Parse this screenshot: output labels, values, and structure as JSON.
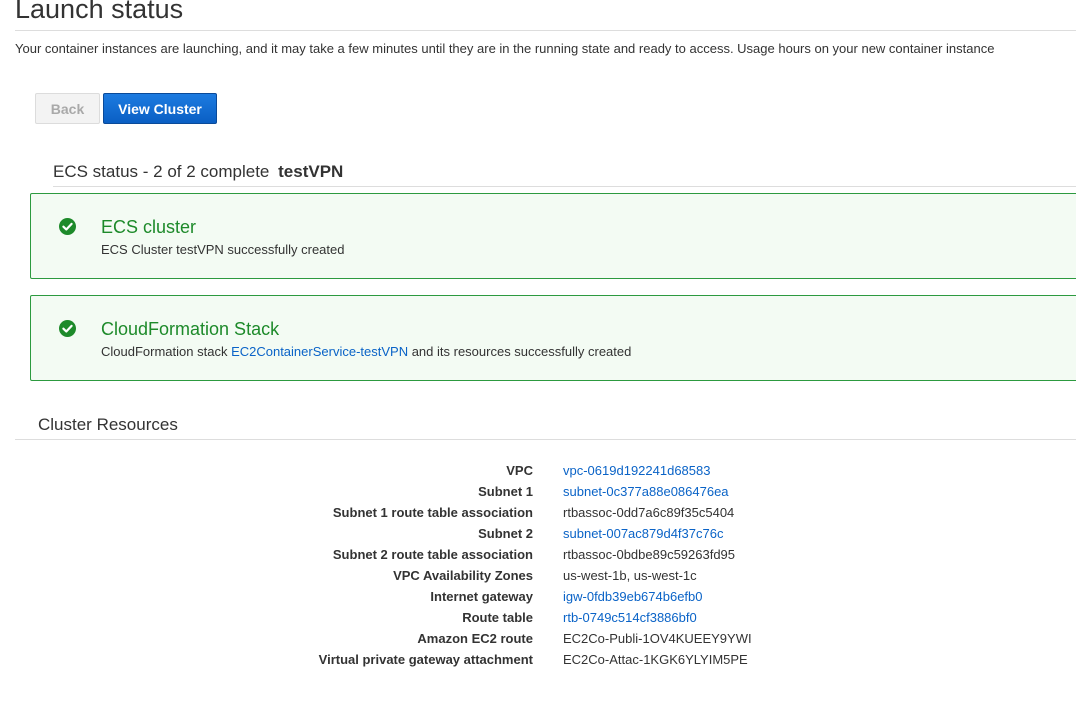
{
  "page": {
    "title": "Launch status",
    "intro": "Your container instances are launching, and it may take a few minutes until they are in the running state and ready to access. Usage hours on your new container instance"
  },
  "buttons": {
    "back_label": "Back",
    "view_cluster_label": "View Cluster"
  },
  "ecs_status": {
    "heading_prefix": "ECS status - 2 of 2 complete",
    "cluster_name": "testVPN",
    "items": [
      {
        "title": "ECS cluster",
        "text_before": "ECS Cluster testVPN successfully created",
        "link": "",
        "text_after": ""
      },
      {
        "title": "CloudFormation Stack",
        "text_before": "CloudFormation stack ",
        "link": "EC2ContainerService-testVPN",
        "text_after": " and its resources successfully created"
      }
    ]
  },
  "cluster_resources": {
    "heading": "Cluster Resources",
    "rows": [
      {
        "label": "VPC",
        "value": "vpc-0619d192241d68583",
        "is_link": true
      },
      {
        "label": "Subnet 1",
        "value": "subnet-0c377a88e086476ea",
        "is_link": true
      },
      {
        "label": "Subnet 1 route table association",
        "value": "rtbassoc-0dd7a6c89f35c5404",
        "is_link": false
      },
      {
        "label": "Subnet 2",
        "value": "subnet-007ac879d4f37c76c",
        "is_link": true
      },
      {
        "label": "Subnet 2 route table association",
        "value": "rtbassoc-0bdbe89c59263fd95",
        "is_link": false
      },
      {
        "label": "VPC Availability Zones",
        "value": "us-west-1b, us-west-1c",
        "is_link": false
      },
      {
        "label": "Internet gateway",
        "value": "igw-0fdb39eb674b6efb0",
        "is_link": true
      },
      {
        "label": "Route table",
        "value": "rtb-0749c514cf3886bf0",
        "is_link": true
      },
      {
        "label": "Amazon EC2 route",
        "value": "EC2Co-Publi-1OV4KUEEY9YWI",
        "is_link": false
      },
      {
        "label": "Virtual private gateway attachment",
        "value": "EC2Co-Attac-1KGK6YLYIM5PE",
        "is_link": false
      }
    ]
  },
  "colors": {
    "success_green": "#1d8a2a",
    "success_border": "#2c9a3f",
    "success_bg": "#f3fbf3",
    "link_blue": "#0a63c7",
    "primary_button": "#0a5fc4"
  },
  "icons": {
    "status_icon": "check-circle-icon"
  }
}
